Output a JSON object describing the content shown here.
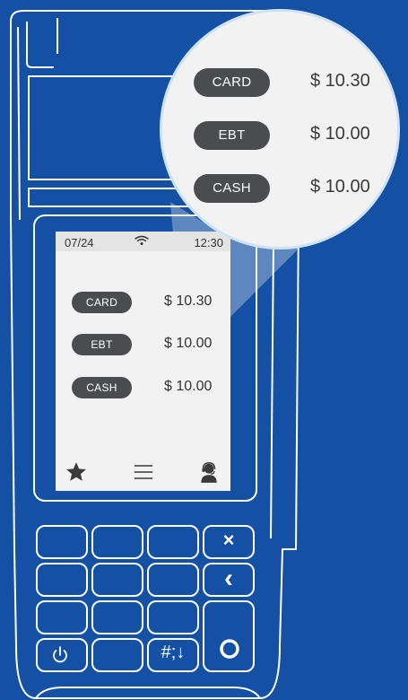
{
  "screen": {
    "status": {
      "date": "07/24",
      "time": "12:30",
      "wifi_icon": "wifi-icon"
    },
    "payments": [
      {
        "method": "CARD",
        "amount": "$ 10.30"
      },
      {
        "method": "EBT",
        "amount": "$ 10.00"
      },
      {
        "method": "CASH",
        "amount": "$ 10.00"
      }
    ],
    "nav": {
      "favorites_icon": "star-icon",
      "menu_icon": "menu-icon",
      "support_icon": "support-agent-icon"
    }
  },
  "zoom": {
    "payments": [
      {
        "method": "CARD",
        "amount": "$ 10.30"
      },
      {
        "method": "EBT",
        "amount": "$ 10.00"
      },
      {
        "method": "CASH",
        "amount": "$ 10.00"
      }
    ]
  },
  "keypad": {
    "cancel_glyph": "×",
    "back_glyph": "‹",
    "symbol_key_label": "#;↓",
    "power_icon": "power-icon",
    "enter_icon": "enter-circle-icon"
  },
  "colors": {
    "background": "#1450a3",
    "outline": "#ffffff",
    "pill": "#4a4c50",
    "screen": "#f2f2f2"
  }
}
